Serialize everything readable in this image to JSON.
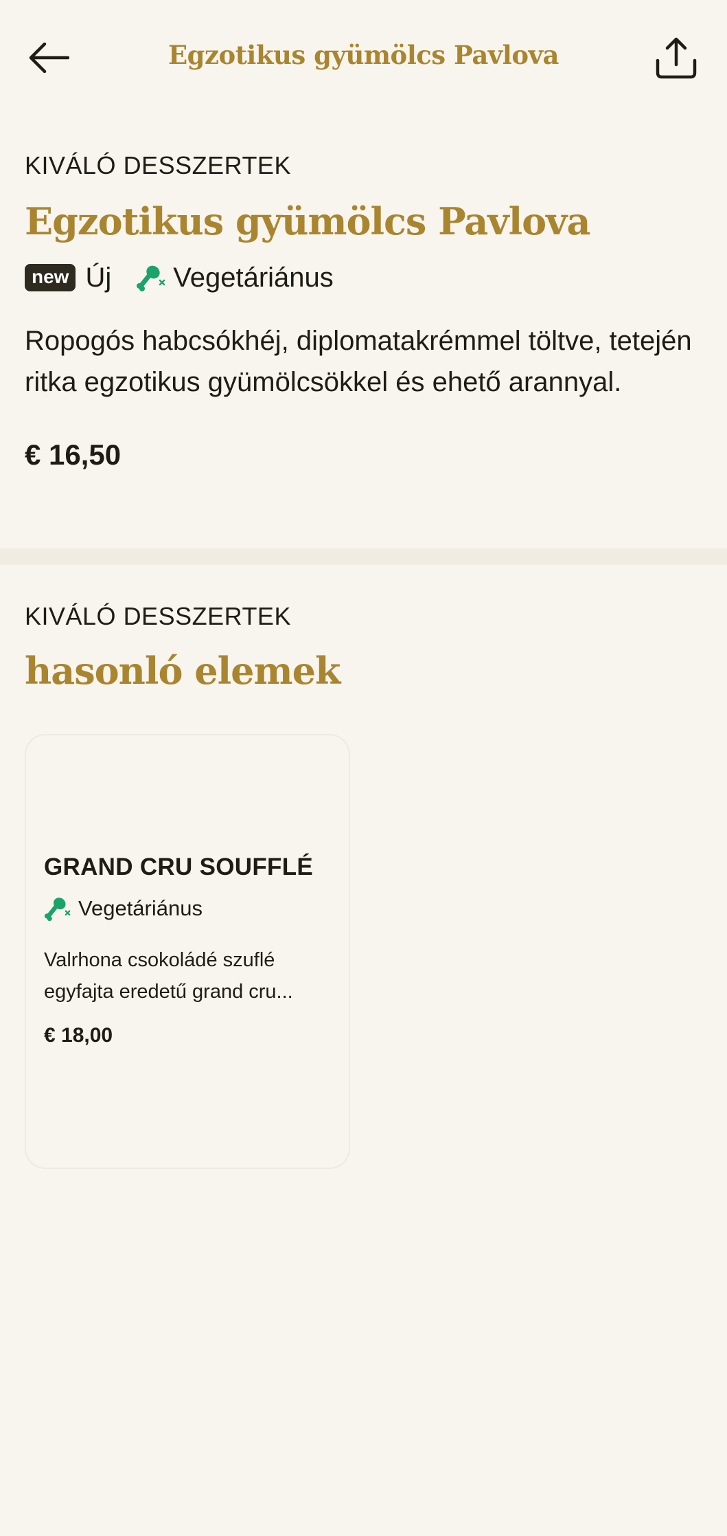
{
  "header": {
    "title": "Egzotikus gyümölcs Pavlova",
    "back_icon": "arrow-left-icon",
    "share_icon": "share-icon"
  },
  "product": {
    "category": "KIVÁLÓ DESSZERTEK",
    "title": "Egzotikus gyümölcs Pavlova",
    "new_badge": "new",
    "new_label": "Új",
    "veg_label": "Vegetáriánus",
    "description": "Ropogós habcsókhéj, diplomatakrémmel töltve, tetején ritka egzotikus gyümölcsökkel és ehető arannyal.",
    "price": "€ 16,50"
  },
  "similar": {
    "category": "KIVÁLÓ DESSZERTEK",
    "title": "hasonló elemek",
    "items": [
      {
        "name": "GRAND CRU SOUFFLÉ",
        "veg_label": "Vegetáriánus",
        "description": "Valrhona csokoládé szuflé egyfajta eredetű grand cru...",
        "price": "€ 18,00"
      }
    ]
  },
  "colors": {
    "accent": "#a9852f",
    "background": "#f8f5ef",
    "veg_green": "#1aa36b",
    "badge_dark": "#2e2a1f"
  }
}
